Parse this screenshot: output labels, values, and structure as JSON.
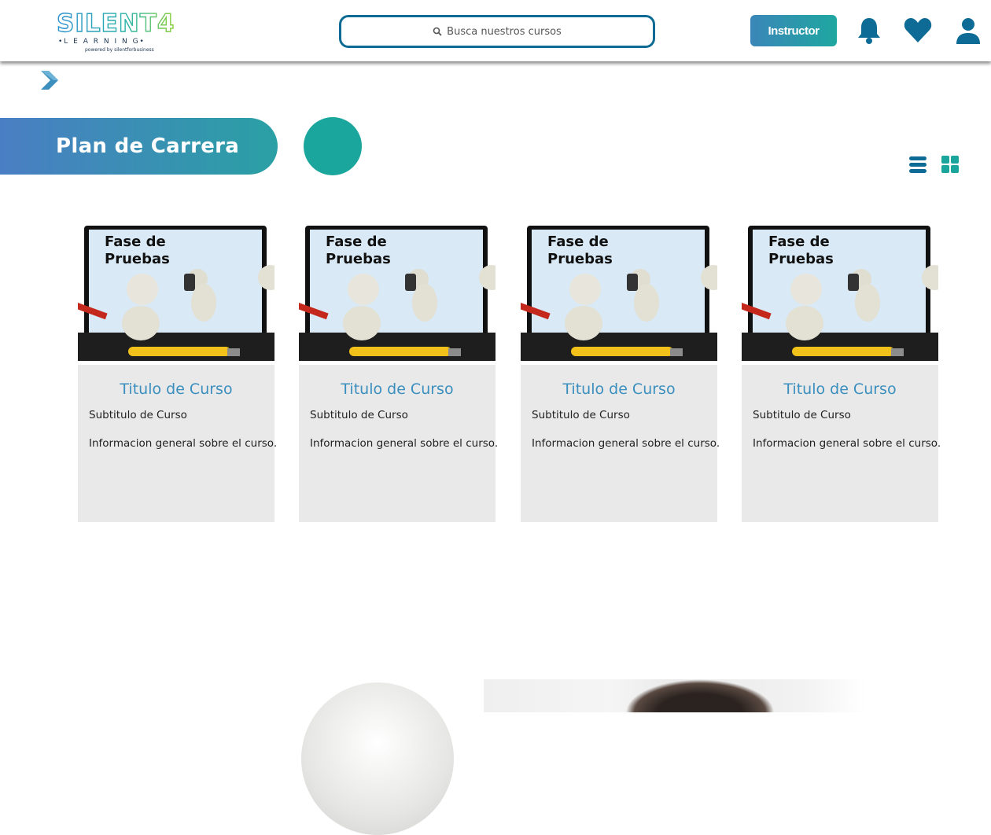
{
  "header": {
    "logo": {
      "brand": "SILENT4",
      "sub": "•L E A R N I N G•",
      "tagline": "powered by silentforbusiness"
    },
    "search_placeholder": "Busca nuestros cursos",
    "instructor_label": "Instructor",
    "accent_color": "#0d6b95"
  },
  "breadcrumb": {
    "icon": "chevron-right-icon"
  },
  "section": {
    "title": "Plan de Carrera",
    "view_icons": [
      "list-view-icon",
      "grid-view-icon"
    ]
  },
  "cards": [
    {
      "image_caption": "Fase de Pruebas",
      "title": "Titulo de Curso",
      "subtitle": "Subtitulo de Curso",
      "info": "Informacion general sobre el curso."
    },
    {
      "image_caption": "Fase de Pruebas",
      "title": "Titulo de Curso",
      "subtitle": "Subtitulo de Curso",
      "info": "Informacion general sobre el curso."
    },
    {
      "image_caption": "Fase de Pruebas",
      "title": "Titulo de Curso",
      "subtitle": "Subtitulo de Curso",
      "info": "Informacion general sobre el curso."
    },
    {
      "image_caption": "Fase de Pruebas",
      "title": "Titulo de Curso",
      "subtitle": "Subtitulo de Curso",
      "info": "Informacion general sobre el curso."
    }
  ]
}
